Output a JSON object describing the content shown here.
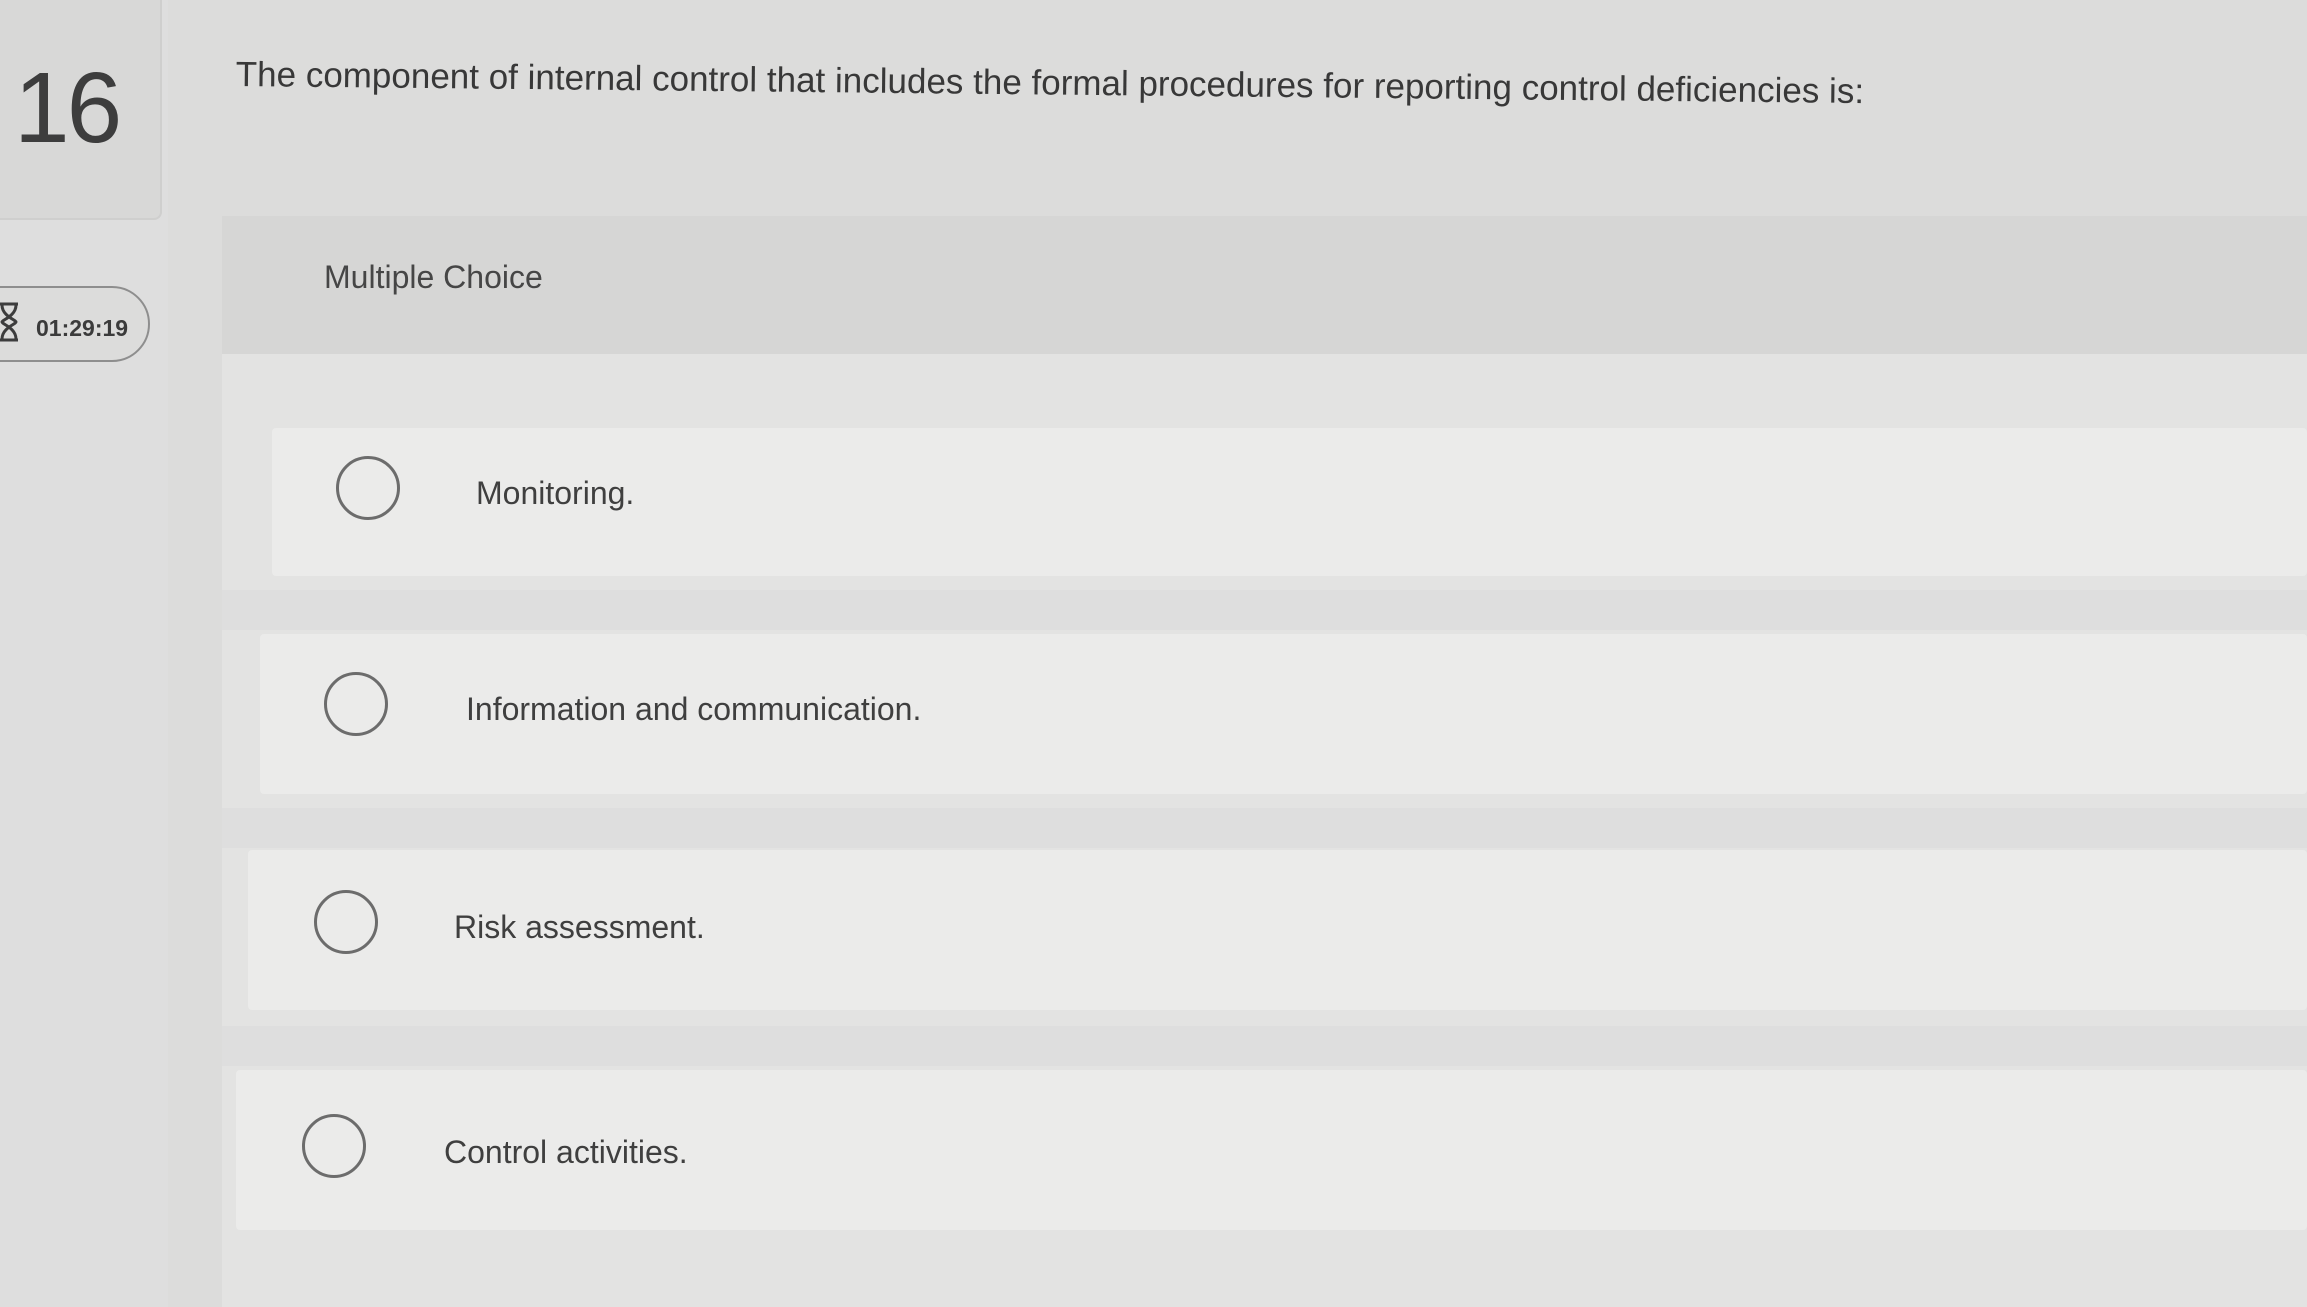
{
  "question": {
    "number": "16",
    "timer": "01:29:19",
    "prompt": "The component of internal control that includes the formal procedures for reporting control deficiencies is:",
    "type": "Multiple Choice"
  },
  "choices": [
    {
      "label": "Monitoring."
    },
    {
      "label": "Information and communication."
    },
    {
      "label": "Risk assessment."
    },
    {
      "label": "Control activities."
    }
  ],
  "icons": {
    "timer": "hourglass-icon",
    "choice_marker": "radio-circle-icon"
  },
  "colors": {
    "page_background": "#dcdcdb",
    "choice_background": "#ebebea",
    "text": "#3c3c3c"
  }
}
